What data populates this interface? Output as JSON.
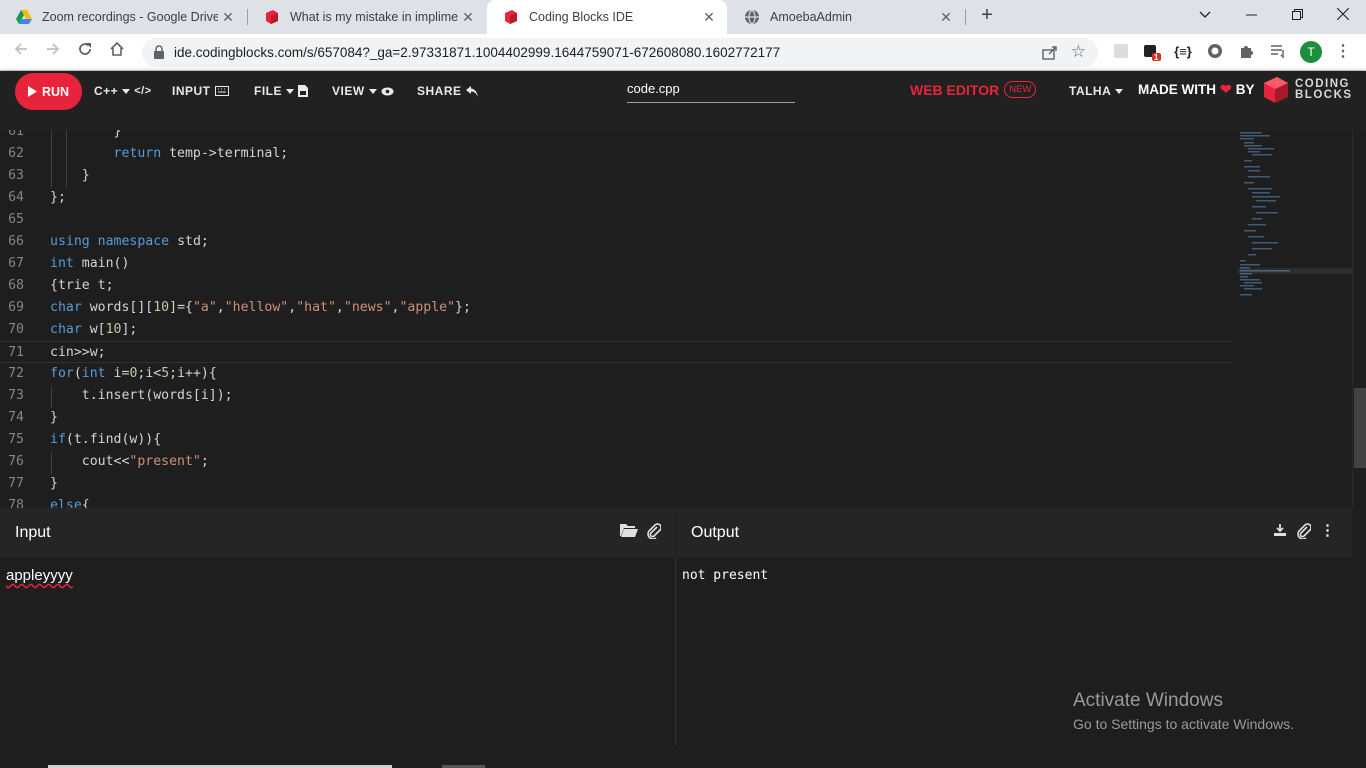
{
  "browser": {
    "tabs": [
      {
        "title": "Zoom recordings - Google Drive",
        "icon": "google-drive-icon"
      },
      {
        "title": "What is my mistake in impliment",
        "icon": "coding-blocks-icon"
      },
      {
        "title": "Coding Blocks IDE",
        "icon": "coding-blocks-icon"
      },
      {
        "title": "AmoebaAdmin",
        "icon": "globe-icon"
      }
    ],
    "close_glyph": "✕",
    "new_tab_glyph": "+",
    "url": "ide.codingblocks.com/s/657084?_ga=2.97331871.1004402999.1644759071-672608080.1602772177",
    "profile_initial": "T",
    "ext_badge": "1"
  },
  "ide": {
    "run_label": "RUN",
    "lang_label": "C++",
    "input_label": "INPUT",
    "file_label": "FILE",
    "view_label": "VIEW",
    "share_label": "SHARE",
    "filename": "code.cpp",
    "web_editor_label": "WEB EDITOR",
    "new_badge": "NEW",
    "user_label": "TALHA",
    "made_with_label": "MADE WITH",
    "by_label": "BY",
    "logo_line1": "CODING",
    "logo_line2": "BLOCKS"
  },
  "code": {
    "lines": [
      {
        "n": "61",
        "text": "        }"
      },
      {
        "n": "62",
        "text": "        return temp->terminal;"
      },
      {
        "n": "63",
        "text": "    }"
      },
      {
        "n": "64",
        "text": "};"
      },
      {
        "n": "65",
        "text": ""
      },
      {
        "n": "66",
        "text": "using namespace std;"
      },
      {
        "n": "67",
        "text": "int main()"
      },
      {
        "n": "68",
        "text": "{trie t;"
      },
      {
        "n": "69",
        "text": "char words[][10]={\"a\",\"hellow\",\"hat\",\"news\",\"apple\"};"
      },
      {
        "n": "70",
        "text": "char w[10];"
      },
      {
        "n": "71",
        "text": "cin>>w;"
      },
      {
        "n": "72",
        "text": "for(int i=0;i<5;i++){"
      },
      {
        "n": "73",
        "text": "    t.insert(words[i]);"
      },
      {
        "n": "74",
        "text": "}"
      },
      {
        "n": "75",
        "text": "if(t.find(w)){"
      },
      {
        "n": "76",
        "text": "    cout<<\"present\";"
      },
      {
        "n": "77",
        "text": "}"
      },
      {
        "n": "78",
        "text": "else{"
      }
    ]
  },
  "input_panel": {
    "title": "Input",
    "value": "appleyyyy"
  },
  "output_panel": {
    "title": "Output",
    "value": "not present"
  },
  "watermark": {
    "line1": "Activate Windows",
    "line2": "Go to Settings to activate Windows."
  },
  "colors": {
    "accent": "#e8243c",
    "keyword": "#569cd6",
    "string": "#ce9178",
    "number": "#b5cea8"
  }
}
